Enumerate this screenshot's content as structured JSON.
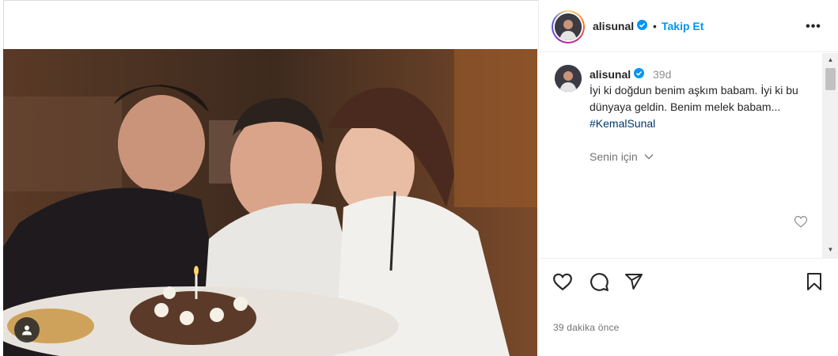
{
  "post": {
    "username": "alisunal",
    "follow_label": "Takip Et",
    "separator": "•",
    "more_label": "•••",
    "comment_time": "39d",
    "caption_text": "İyi ki doğdun benim aşkım babam. İyi ki bu dünyaya geldin. Benim melek babam... ",
    "hashtag": "#KemalSunal",
    "translate_label": "Senin için",
    "posted_ago": "39 dakika önce"
  },
  "icons": {
    "verified": "verified-badge-icon",
    "like": "heart-icon",
    "comment": "comment-icon",
    "share": "share-icon",
    "save": "bookmark-icon",
    "tags": "user-tag-icon",
    "comment_like": "heart-icon"
  },
  "colors": {
    "accent": "#0095f6",
    "verified": "#0095f6",
    "hashtag": "#00376b",
    "muted": "#737373"
  }
}
